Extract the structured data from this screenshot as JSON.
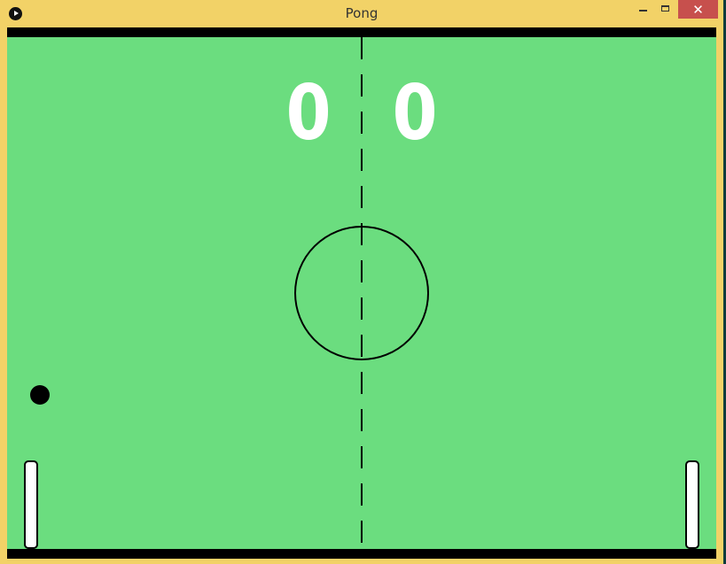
{
  "window": {
    "title": "Pong",
    "close_glyph": "✕"
  },
  "scores": {
    "left": "0",
    "right": "0"
  },
  "icons": {
    "app": "play-icon",
    "minimize": "minimize-icon",
    "maximize": "maximize-icon",
    "close": "close-icon"
  },
  "colors": {
    "window_frame": "#f2d267",
    "court": "#6bdd7f",
    "walls": "#000000",
    "paddles": "#ffffff",
    "ball": "#000000",
    "score": "#ffffff",
    "close_button": "#c7504d"
  }
}
